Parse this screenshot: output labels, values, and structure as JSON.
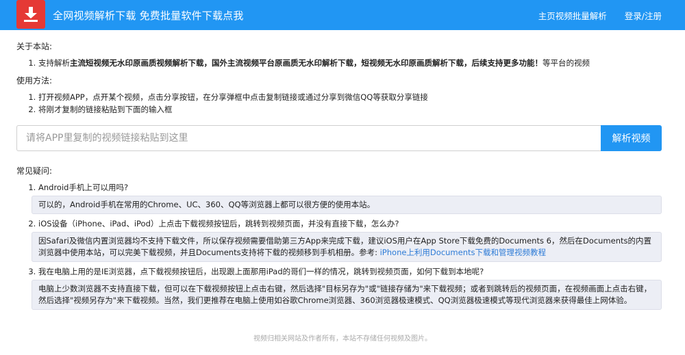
{
  "header": {
    "brand": "全网视频解析下载   免费批量软件下载点我",
    "nav": [
      "主页视频批量解析",
      "登录/注册"
    ]
  },
  "about": {
    "title": "关于本站:",
    "item_prefix": "支持解析",
    "item_strong": "主流短视频无水印原画质视频解析下载，国外主流视频平台原画质无水印解析下载，短视频无水印原画质解析下载，后续支持更多功能！",
    "item_suffix": "等平台的视频"
  },
  "usage": {
    "title": "使用方法:",
    "steps": [
      "打开视频APP，点开某个视频，点击分享按钮，在分享弹框中点击复制链接或通过分享到微信QQ等获取分享链接",
      "将刚才复制的链接粘贴到下面的输入框"
    ]
  },
  "search": {
    "placeholder": "请将APP里复制的视频链接粘贴到这里",
    "value": "",
    "button": "解析视频"
  },
  "faq": {
    "title": "常见疑问:",
    "q1": "Android手机上可以用吗?",
    "a1": "可以的，Android手机在常用的Chrome、UC、360、QQ等浏览器上都可以很方便的使用本站。",
    "q2": "iOS设备（iPhone、iPad、iPod）上点击下载视频按钮后，跳转到视频页面，并没有直接下载，怎么办?",
    "a2": "因Safari及微信内置浏览器均不支持下载文件，所以保存视频需要借助第三方App来完成下载，建议iOS用户在App Store下载免费的Documents 6，然后在Documents的内置浏览器中使用本站，可以完美下载视频，并且Documents支持将下载的视频移到手机相册。参考: ",
    "a2_link": "iPhone上利用Documents下载和管理视频教程",
    "q3": "我在电脑上用的是IE浏览器，点下载视频按钮后，出现跟上面那用iPad的哥们一样的情况，跳转到视频页面，如何下载到本地呢?",
    "a3": "电脑上少数浏览器不支持直接下载，但可以在下载视频按钮上点击右键，然后选择\"目标另存为\"或\"链接存储为\"来下载视频；或者到跳转后的视频页面，在视频画面上点击右键，然后选择\"视频另存为\"来下载视频。当然，我们更推荐在电脑上使用如谷歌Chrome浏览器、360浏览器极速模式、QQ浏览器极速模式等现代浏览器来获得最佳上网体验。"
  },
  "footer": "视频归相关网站及作者所有，本站不存储任何视频及图片。",
  "colors": {
    "primary": "#2196f3",
    "logo": "#e53935",
    "answer_bg": "#eceef5",
    "link": "#2d7bd6"
  }
}
